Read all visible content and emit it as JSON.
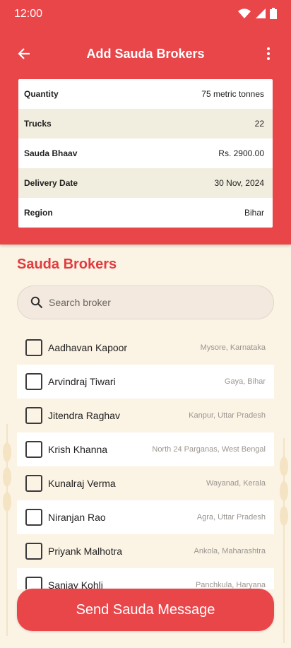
{
  "status_bar": {
    "time": "12:00"
  },
  "app_bar": {
    "title": "Add Sauda Brokers"
  },
  "details": [
    {
      "label": "Quantity",
      "value": "75 metric tonnes"
    },
    {
      "label": "Trucks",
      "value": "22"
    },
    {
      "label": "Sauda Bhaav",
      "value": "Rs. 2900.00"
    },
    {
      "label": "Delivery Date",
      "value": "30 Nov, 2024"
    },
    {
      "label": "Region",
      "value": "Bihar"
    }
  ],
  "brokers_section": {
    "title": "Sauda Brokers",
    "search_placeholder": "Search broker"
  },
  "brokers": [
    {
      "name": "Aadhavan Kapoor",
      "location": "Mysore, Karnataka",
      "checked": false
    },
    {
      "name": "Arvindraj Tiwari",
      "location": "Gaya, Bihar",
      "checked": false
    },
    {
      "name": "Jitendra Raghav",
      "location": "Kanpur, Uttar Pradesh",
      "checked": false
    },
    {
      "name": "Krish Khanna",
      "location": "North 24 Parganas, West Bengal",
      "checked": false
    },
    {
      "name": "Kunalraj Verma",
      "location": "Wayanad, Kerala",
      "checked": false
    },
    {
      "name": "Niranjan Rao",
      "location": "Agra, Uttar Pradesh",
      "checked": false
    },
    {
      "name": "Priyank Malhotra",
      "location": "Ankola, Maharashtra",
      "checked": false
    },
    {
      "name": "Sanjay Kohli",
      "location": "Panchkula, Haryana",
      "checked": false
    }
  ],
  "actions": {
    "send_label": "Send Sauda Message"
  },
  "colors": {
    "primary": "#e9464a",
    "background": "#fbf3e4",
    "title_red": "#e23b3f"
  }
}
